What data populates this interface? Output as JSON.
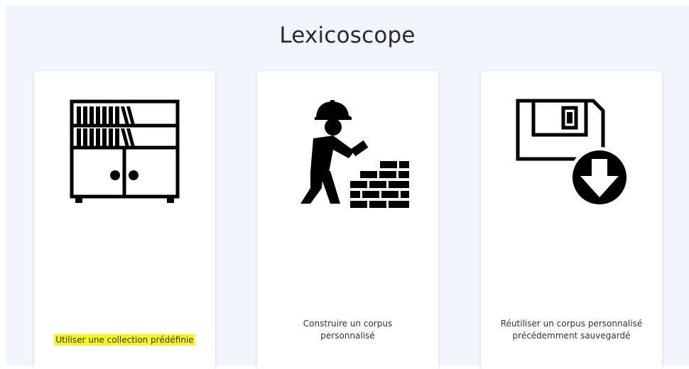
{
  "app": {
    "title": "Lexicoscope"
  },
  "colors": {
    "page_bg": "#f2f6fa",
    "card_bg": "#ffffff",
    "highlight": "#f7f71f",
    "icon": "#000000"
  },
  "cards": [
    {
      "icon": "bookshelf-icon",
      "label": "Utiliser une collection prédéfinie",
      "highlighted": true
    },
    {
      "icon": "worker-building-wall-icon",
      "label_line1": "Construire un corpus",
      "label_line2": "personnalisé"
    },
    {
      "icon": "floppy-disk-download-icon",
      "label_line1": "Réutiliser un corpus personnalisé",
      "label_line2": "précédemment sauvegardé"
    }
  ]
}
